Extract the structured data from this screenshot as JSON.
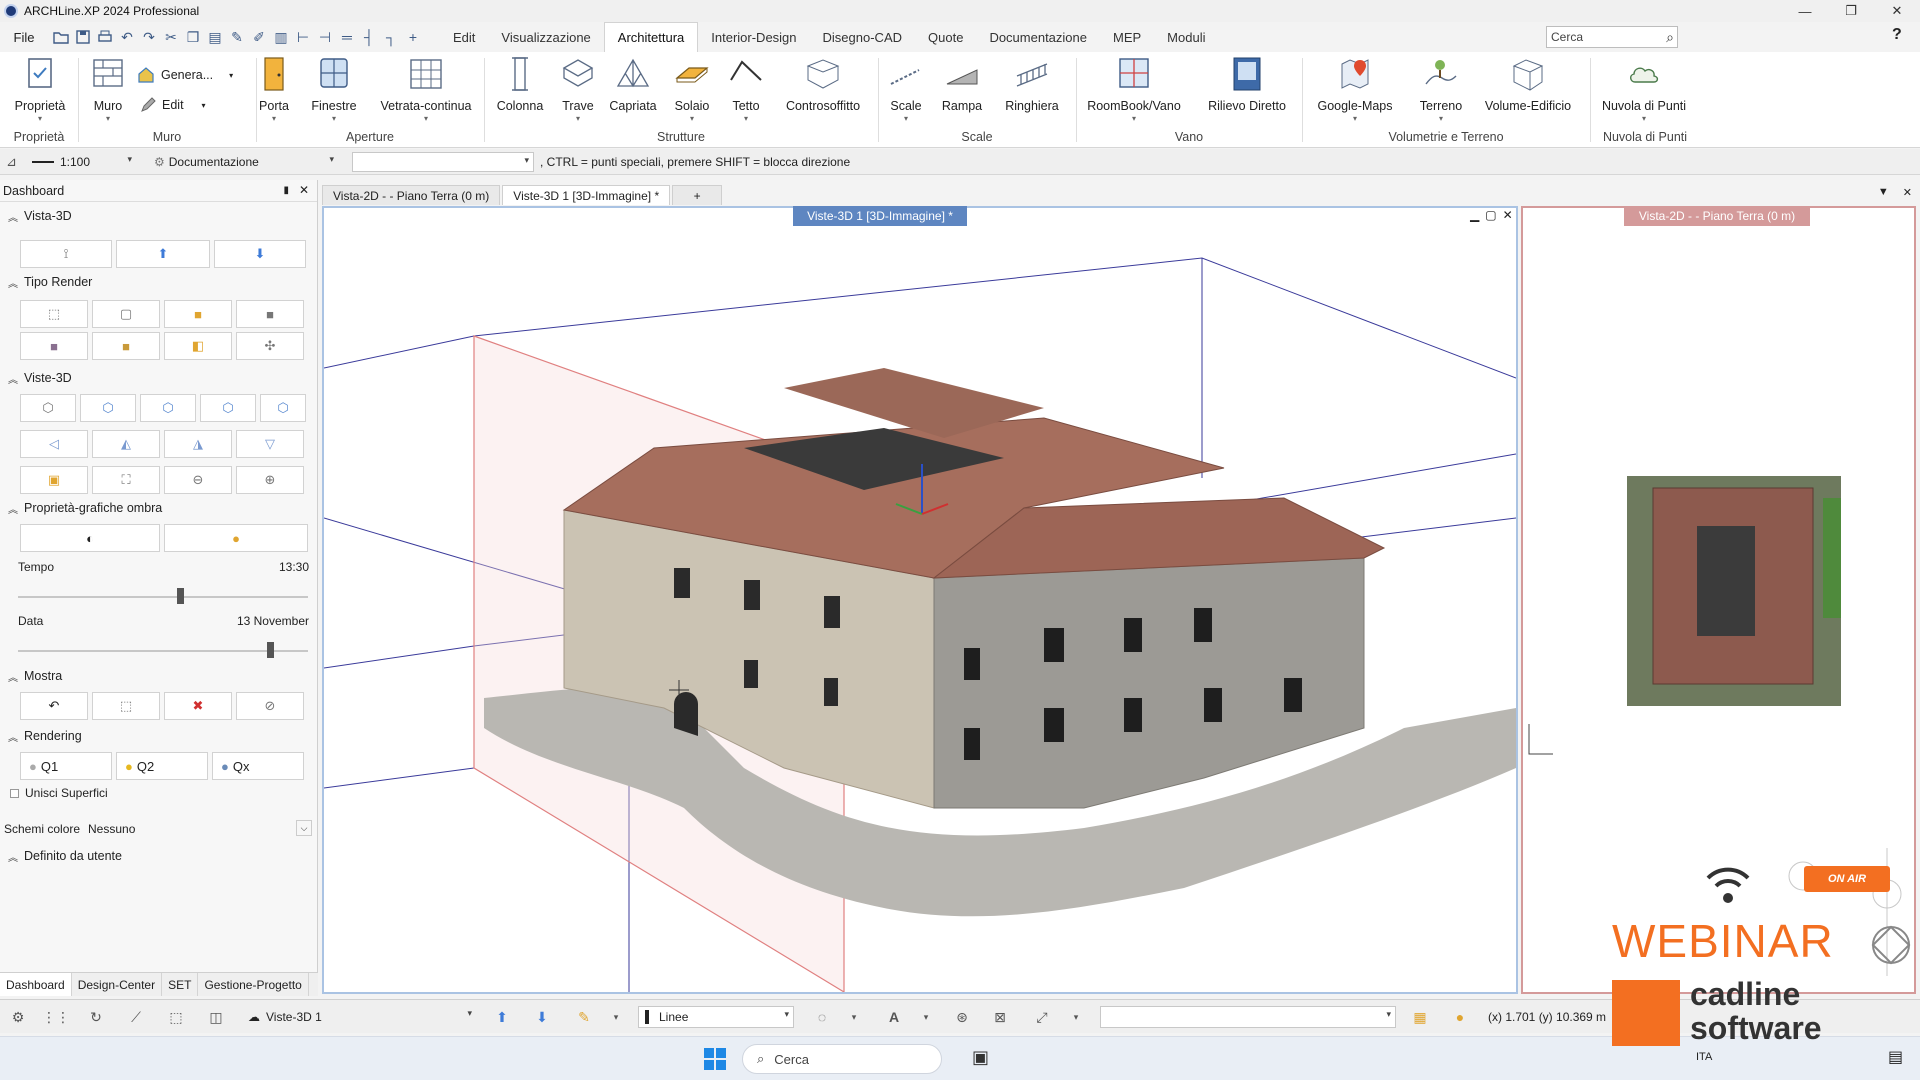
{
  "window": {
    "title": "ARCHLine.XP 2024 Professional",
    "minimize": "—",
    "maximize": "❐",
    "close": "✕"
  },
  "menu": {
    "file": "File",
    "tabs": [
      "Edit",
      "Visualizzazione",
      "Architettura",
      "Interior-Design",
      "Disegno-CAD",
      "Quote",
      "Documentazione",
      "MEP",
      "Moduli"
    ],
    "active_tab": "Architettura",
    "search_placeholder": "Cerca",
    "help": "?"
  },
  "ribbon": {
    "groups": [
      "Proprietà",
      "Muro",
      "Aperture",
      "Strutture",
      "Scale",
      "Vano",
      "Volumetrie e Terreno",
      "Nuvola di Punti"
    ],
    "buttons": {
      "proprieta": "Proprietà",
      "muro": "Muro",
      "genera": "Genera...",
      "edit": "Edit",
      "porta": "Porta",
      "finestre": "Finestre",
      "vetrata": "Vetrata-continua",
      "colonna": "Colonna",
      "trave": "Trave",
      "capriata": "Capriata",
      "solaio": "Solaio",
      "tetto": "Tetto",
      "controsoffitto": "Controsoffitto",
      "scale": "Scale",
      "rampa": "Rampa",
      "ringhiera": "Ringhiera",
      "roombook": "RoomBook/Vano",
      "rilievo": "Rilievo Diretto",
      "googlemaps": "Google-Maps",
      "terreno": "Terreno",
      "volume": "Volume-Edificio",
      "nuvola": "Nuvola di Punti"
    }
  },
  "statusbar": {
    "scale": "1:100",
    "layer": "Documentazione",
    "hint": "CTRL = punti speciali, premere SHIFT = blocca direzione"
  },
  "dashboard": {
    "title": "Dashboard",
    "sections": {
      "vista3d": "Vista-3D",
      "tipo_render": "Tipo Render",
      "viste3d": "Viste-3D",
      "ombra": "Proprietà-grafiche ombra",
      "mostra": "Mostra",
      "rendering": "Rendering",
      "definito": "Definito da utente"
    },
    "tempo_label": "Tempo",
    "tempo_value": "13:30",
    "tempo_fraction": 0.56,
    "data_label": "Data",
    "data_value": "13 November",
    "data_fraction": 0.87,
    "q1": "Q1",
    "q2": "Q2",
    "qx": "Qx",
    "unisci": "Unisci Superfici",
    "schemi_label": "Schemi colore",
    "schemi_value": "Nessuno",
    "bottom_tabs": [
      "Dashboard",
      "Design-Center",
      "SET",
      "Gestione-Progetto"
    ]
  },
  "documents": {
    "tabs": [
      "Vista-2D -  - Piano Terra (0 m)",
      "Viste-3D 1 [3D-Immagine] *"
    ],
    "plus": "+",
    "view3d_title": "Viste-3D 1 [3D-Immagine] *",
    "view2d_title": "Vista-2D -  - Piano Terra (0 m)"
  },
  "bottombar": {
    "view": "Viste-3D 1",
    "line_type": "Linee",
    "coords": "(x) 1.701   (y) 10.369 m"
  },
  "taskbar": {
    "search": "Cerca",
    "lang": "ITA"
  },
  "overlay": {
    "onair": "ON AIR",
    "webinar": "WEBINAR",
    "brand1": "cadline",
    "brand2": "software"
  },
  "colors": {
    "accent_3d": "#5e86c1",
    "accent_2d": "#d49a9a",
    "webinar_orange": "#f36f21"
  }
}
